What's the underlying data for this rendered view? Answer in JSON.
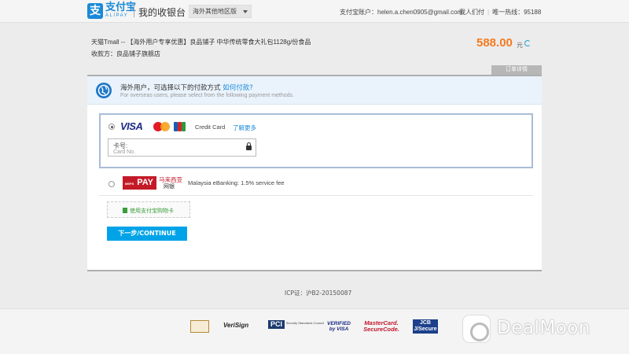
{
  "header": {
    "logo_glyph": "支",
    "logo_name": "支付宝",
    "logo_sub": "ALIPAY",
    "cashier_title": "我的收银台",
    "region_selector": "海外其他地区版",
    "account_label": "支付宝账户：",
    "account_email": "helen.a.chen0905@gmail.com",
    "link_help": "我人们付",
    "link_hotline": "唯一热线：95188"
  },
  "order": {
    "title": "天猫Tmall -- 【海外用户专享优惠】良品铺子 中华传统零食大礼包1128g/份食品",
    "seller": "收款方：良品铺子旗舰店",
    "amount": "588.00",
    "currency": "元",
    "detail_tab": "订单详情"
  },
  "notice": {
    "text_cn": "海外用户，可选择以下的付款方式 ",
    "how_link": "如何付款?",
    "text_en": "For overseas users, please select from the following payment methods."
  },
  "credit_card": {
    "visa": "VISA",
    "label": "Credit Card",
    "more_link": "了解更多",
    "input_label": "卡号:",
    "input_placeholder": "Card No."
  },
  "mepay": {
    "logo_small": "MEPS",
    "logo_main": "PAY",
    "logo_cn1": "马来西亚",
    "logo_cn2": "网银",
    "description": "Malaysia eBanking: 1.5% service fee"
  },
  "voucher": {
    "label": "使用支付宝购物卡"
  },
  "continue_button": "下一步/CONTINUE",
  "icp": "ICP证：沪B2-20150087",
  "footer_badges": {
    "verisign": "VeriSign",
    "pci": "PCI",
    "pci_sub": "Security Standards Council",
    "verified_visa": "VERIFIED by VISA",
    "mastercard": "MasterCard. SecureCode.",
    "jcb": "JCB J/Secure"
  },
  "watermark": "DealMoon",
  "colors": {
    "brand_blue": "#1a8ad8",
    "amount_orange": "#f47a20",
    "button_blue": "#00a3e8"
  }
}
